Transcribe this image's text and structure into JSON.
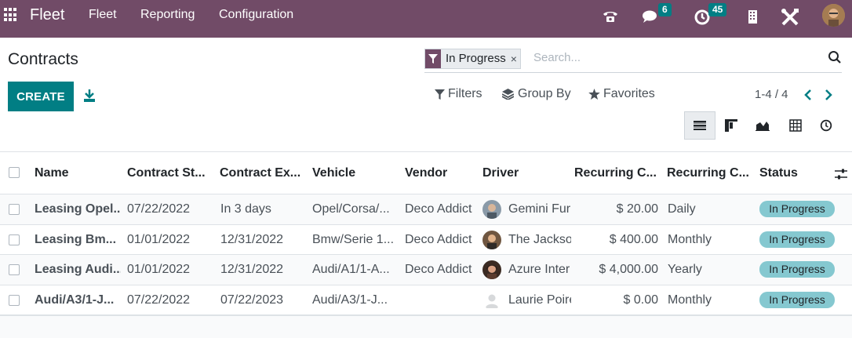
{
  "topbar": {
    "brand": "Fleet",
    "menu": [
      "Fleet",
      "Reporting",
      "Configuration"
    ],
    "messages_count": "6",
    "activities_count": "45",
    "bg_color": "#714b67"
  },
  "control": {
    "title": "Contracts",
    "create_label": "CREATE",
    "facet_label": "In Progress",
    "facet_close": "×",
    "search_placeholder": "Search...",
    "filters_label": "Filters",
    "groupby_label": "Group By",
    "favorites_label": "Favorites",
    "pager": "1-4 / 4",
    "pager_prev": "‹",
    "pager_next": "›"
  },
  "table": {
    "headers": [
      "Name",
      "Contract St...",
      "Contract Ex...",
      "Vehicle",
      "Vendor",
      "Driver",
      "Recurring C...",
      "Recurring C...",
      "Status"
    ],
    "rows": [
      {
        "name": "Leasing Opel...",
        "start": "07/22/2022",
        "expiry": "In 3 days",
        "vehicle": "Opel/Corsa/...",
        "vendor": "Deco Addict",
        "driver": "Gemini Furn",
        "cost": "$ 20.00",
        "frequency": "Daily",
        "status": "In Progress"
      },
      {
        "name": "Leasing Bm...",
        "start": "01/01/2022",
        "expiry": "12/31/2022",
        "vehicle": "Bmw/Serie 1...",
        "vendor": "Deco Addict",
        "driver": "The Jackso",
        "cost": "$ 400.00",
        "frequency": "Monthly",
        "status": "In Progress"
      },
      {
        "name": "Leasing Audi...",
        "start": "01/01/2022",
        "expiry": "12/31/2022",
        "vehicle": "Audi/A1/1-A...",
        "vendor": "Deco Addict",
        "driver": "Azure Inter",
        "cost": "$ 4,000.00",
        "frequency": "Yearly",
        "status": "In Progress"
      },
      {
        "name": "Audi/A3/1-J...",
        "start": "07/22/2022",
        "expiry": "07/22/2023",
        "vehicle": "Audi/A3/1-J...",
        "vendor": "",
        "driver": "Laurie Poire",
        "cost": "$ 0.00",
        "frequency": "Monthly",
        "status": "In Progress"
      }
    ]
  },
  "colors": {
    "accent": "#017e84",
    "status_bg": "#85c8d0"
  }
}
